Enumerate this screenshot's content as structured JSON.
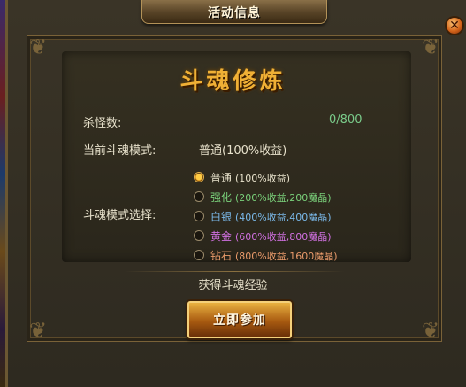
{
  "window": {
    "title": "活动信息",
    "close_icon": "close-icon"
  },
  "heading": "斗魂修炼",
  "stats": {
    "kill_label": "杀怪数:",
    "kill_value": "0/800",
    "mode_label": "当前斗魂模式:",
    "mode_value": "普通(100%收益)"
  },
  "mode_select": {
    "label": "斗魂模式选择:",
    "selected_index": 0,
    "options": [
      {
        "name": "普通",
        "desc": "(100%收益)",
        "color": "#e8e2cc"
      },
      {
        "name": "强化",
        "desc": "(200%收益,200魔晶)",
        "color": "#7ad07a"
      },
      {
        "name": "白银",
        "desc": "(400%收益,400魔晶)",
        "color": "#7ab8e8"
      },
      {
        "name": "黄金",
        "desc": "(600%收益,800魔晶)",
        "color": "#d070e0"
      },
      {
        "name": "钻石",
        "desc": "(800%收益,1600魔晶)",
        "color": "#e89a6a"
      }
    ]
  },
  "gain_text": "获得斗魂经验",
  "join_button": "立即参加"
}
